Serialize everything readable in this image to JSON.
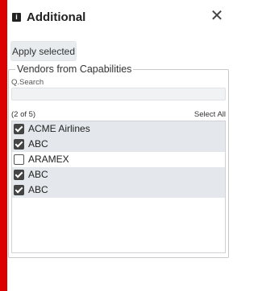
{
  "header": {
    "icon": "info-square-icon",
    "icon_glyph": "i",
    "title": "Additional",
    "close_glyph": "✕"
  },
  "toolbar": {
    "apply_label": "Apply selected"
  },
  "vendors": {
    "legend": "Vendors from Capabilities",
    "search_label": "Q.Search",
    "search_value": "",
    "selection_count": "(2 of 5)",
    "select_all_label": "Select All",
    "items": [
      {
        "label": "ACME Airlines",
        "checked": true
      },
      {
        "label": "ABC",
        "checked": true
      },
      {
        "label": "ARAMEX",
        "checked": false
      },
      {
        "label": "ABC",
        "checked": true
      },
      {
        "label": "ABC",
        "checked": true
      }
    ]
  },
  "colors": {
    "accent_bar": "#dd0000",
    "checked_row": "#e4e7eb",
    "checkbox_fill": "#444444"
  }
}
